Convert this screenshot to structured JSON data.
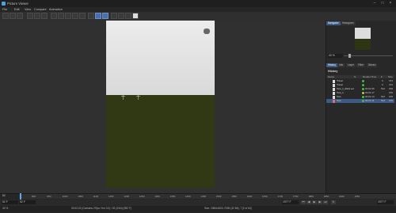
{
  "window": {
    "title": "Picture Viewer"
  },
  "menu": [
    "File",
    "Edit",
    "View",
    "Compare",
    "Animation"
  ],
  "tabs": [
    "Navigator",
    "Histogram"
  ],
  "zoom": "40 %",
  "subtabs": [
    "History",
    "Info",
    "Layer",
    "Filter",
    "Stereo"
  ],
  "history": {
    "title": "History",
    "columns": [
      "Name",
      "S.",
      "Render Time",
      "F.",
      "Size"
    ],
    "rows": [
      {
        "name": "*Final",
        "time": "",
        "frame": "0",
        "size": "472"
      },
      {
        "name": "*Final",
        "time": "",
        "frame": "0",
        "size": "472"
      },
      {
        "name": "Test_1_0912.exr",
        "time": "00:01:56",
        "frame": "512",
        "size": "156"
      },
      {
        "name": "Test_1",
        "time": "00:01:17",
        "frame": "",
        "size": "156"
      },
      {
        "name": "Test",
        "time": "00:01:13",
        "frame": "512",
        "size": "156"
      },
      {
        "name": "Test",
        "time": "00:01:11",
        "frame": "512",
        "size": "156"
      }
    ]
  },
  "timeline": {
    "start_frame": "52",
    "ticks": [
      "900",
      "950",
      "1000",
      "1050",
      "1100",
      "1150",
      "1200",
      "1250",
      "1300",
      "1350",
      "1400",
      "1450",
      "1500",
      "1550",
      "1600",
      "1650",
      "1700",
      "1750",
      "1800",
      "1850",
      "1900",
      "1950"
    ],
    "current": "52 F",
    "end": "1977 F",
    "right_field": "1977 F"
  },
  "status": {
    "zoom": "40 %",
    "time": "00:02:22 (Contains 27fps / frm 0.0) / 52 (2/64) (952 F)",
    "size": "Size: 1984x1603, RGB (32 Bit), 7 [2 of 64]"
  },
  "colors": {
    "accent": "#3d5a86",
    "status_green": "#3fbf4a",
    "status_yellow": "#d6c23a"
  }
}
